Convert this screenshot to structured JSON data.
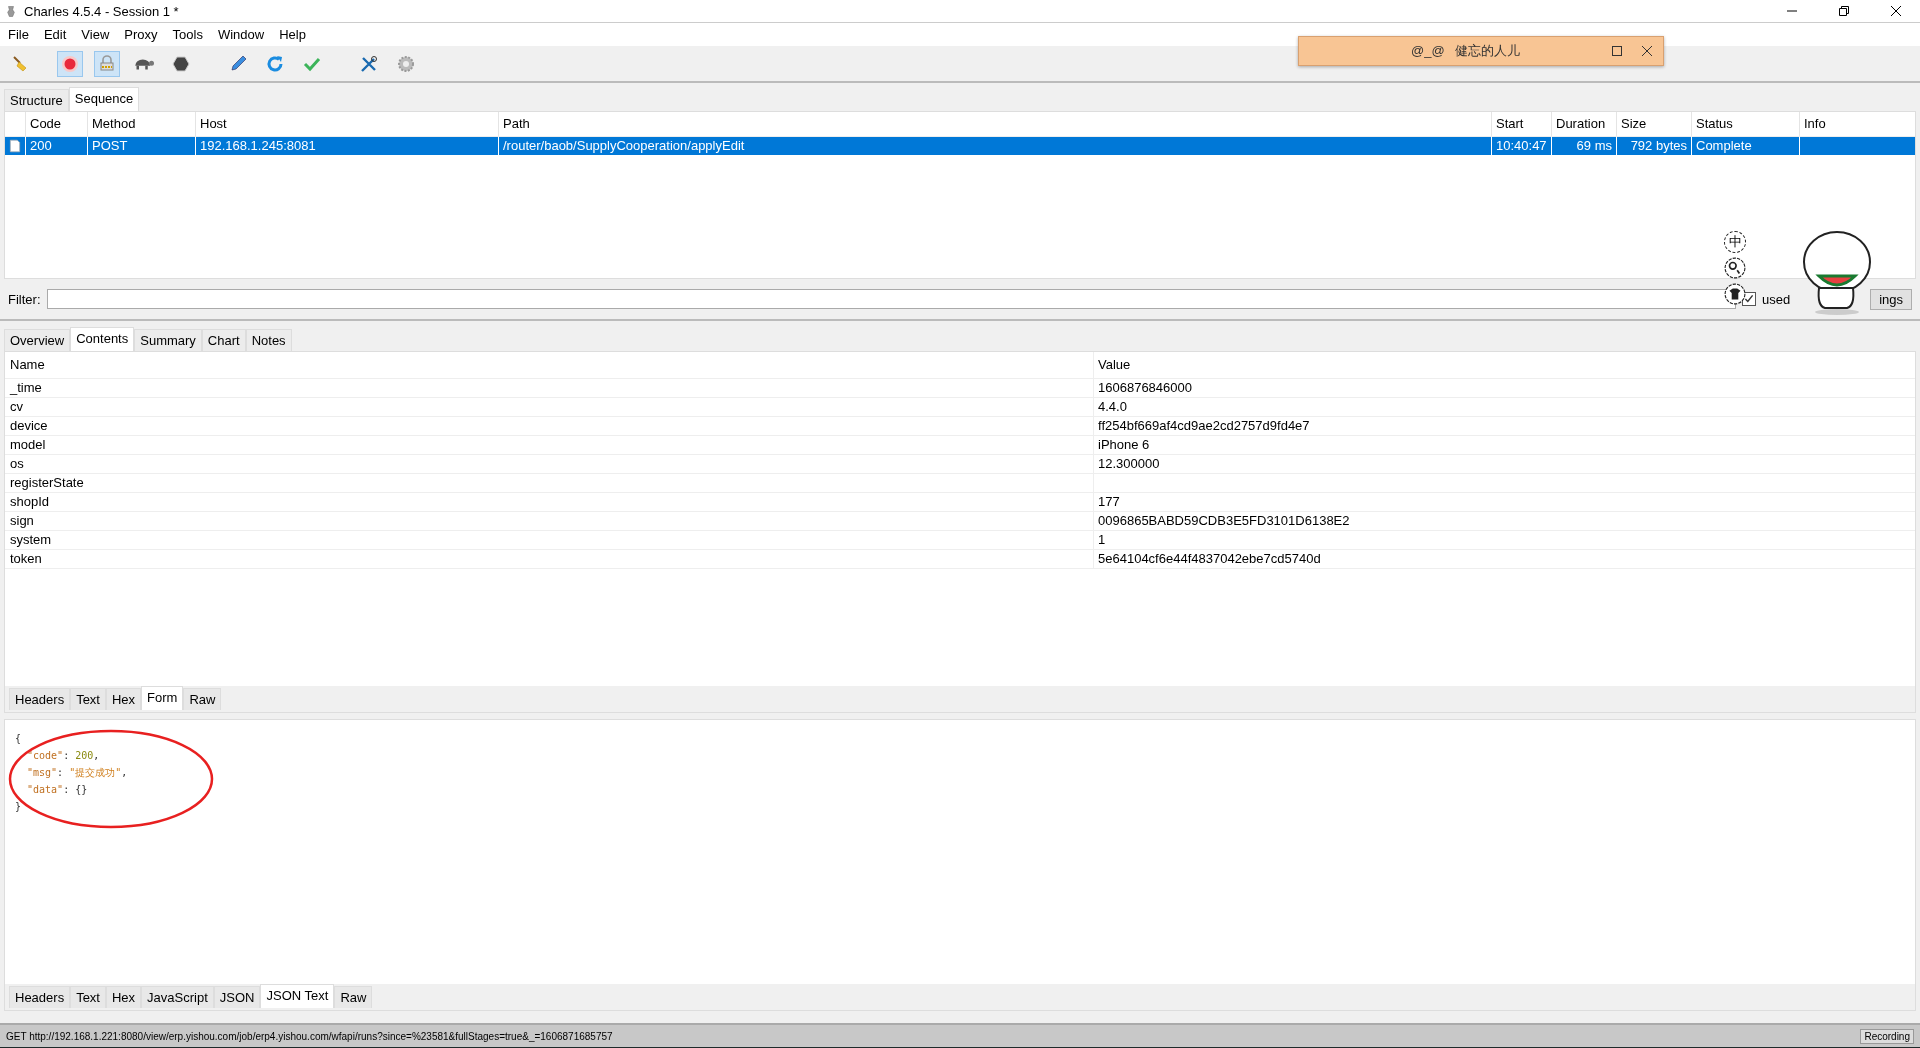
{
  "window": {
    "title": "Charles 4.5.4 - Session 1 *"
  },
  "menu": [
    "File",
    "Edit",
    "View",
    "Proxy",
    "Tools",
    "Window",
    "Help"
  ],
  "toolbar": [
    {
      "kind": "broom",
      "on": false
    },
    {
      "kind": "record",
      "on": true
    },
    {
      "kind": "throttle",
      "on": true
    },
    {
      "kind": "turtle",
      "on": false
    },
    {
      "kind": "stop",
      "on": false
    },
    {
      "kind": "pen",
      "on": false
    },
    {
      "kind": "refresh",
      "on": false
    },
    {
      "kind": "check",
      "on": false
    },
    {
      "kind": "tools",
      "on": false
    },
    {
      "kind": "gear",
      "on": false
    }
  ],
  "notification": {
    "text": "@_@   健忘的人儿"
  },
  "view_tabs": [
    {
      "label": "Structure",
      "selected": false
    },
    {
      "label": "Sequence",
      "selected": true
    }
  ],
  "table": {
    "columns": [
      "Code",
      "Method",
      "Host",
      "Path",
      "Start",
      "Duration",
      "Size",
      "Status",
      "Info"
    ],
    "rows": [
      {
        "selected": true,
        "cells": [
          "200",
          "POST",
          "192.168.1.245:8081",
          "/router/baob/SupplyCooperation/applyEdit",
          "10:40:47",
          "69 ms",
          "792 bytes",
          "Complete",
          ""
        ]
      }
    ]
  },
  "filter": {
    "label": "Filter:",
    "focused_checked": true,
    "checkbox_label": "used",
    "settings_button": "ings"
  },
  "overlay_badge": "中",
  "detail_tabs": [
    {
      "label": "Overview",
      "selected": false
    },
    {
      "label": "Contents",
      "selected": true
    },
    {
      "label": "Summary",
      "selected": false
    },
    {
      "label": "Chart",
      "selected": false
    },
    {
      "label": "Notes",
      "selected": false
    }
  ],
  "form": {
    "columns": [
      "Name",
      "Value"
    ],
    "rows": [
      {
        "name": "_time",
        "value": "1606876846000"
      },
      {
        "name": "cv",
        "value": "4.4.0"
      },
      {
        "name": "device",
        "value": "ff254bf669af4cd9ae2cd2757d9fd4e7"
      },
      {
        "name": "model",
        "value": "iPhone 6"
      },
      {
        "name": "os",
        "value": "12.300000"
      },
      {
        "name": "registerState",
        "value": ""
      },
      {
        "name": "shopId",
        "value": "177"
      },
      {
        "name": "sign",
        "value": "0096865BABD59CDB3E5FD3101D6138E2"
      },
      {
        "name": "system",
        "value": "1"
      },
      {
        "name": "token",
        "value": "5e64104cf6e44f4837042ebe7cd5740d"
      }
    ]
  },
  "request_tabs": [
    {
      "label": "Headers",
      "selected": false
    },
    {
      "label": "Text",
      "selected": false
    },
    {
      "label": "Hex",
      "selected": false
    },
    {
      "label": "Form",
      "selected": true
    },
    {
      "label": "Raw",
      "selected": false
    }
  ],
  "json_text": [
    {
      "tokens": [
        {
          "kind": "punct",
          "text": "{"
        }
      ]
    },
    {
      "tokens": [
        {
          "kind": "key",
          "text": "\"code\""
        },
        {
          "kind": "punct",
          "text": ": "
        },
        {
          "kind": "number",
          "text": "200"
        },
        {
          "kind": "punct",
          "text": ","
        }
      ]
    },
    {
      "tokens": [
        {
          "kind": "key",
          "text": "\"msg\""
        },
        {
          "kind": "punct",
          "text": ": "
        },
        {
          "kind": "string",
          "text": "\"提交成功\""
        },
        {
          "kind": "punct",
          "text": ","
        }
      ]
    },
    {
      "tokens": [
        {
          "kind": "key",
          "text": "\"data\""
        },
        {
          "kind": "punct",
          "text": ": "
        },
        {
          "kind": "punct",
          "text": "{}"
        }
      ]
    },
    {
      "tokens": [
        {
          "kind": "punct",
          "text": "}"
        }
      ]
    }
  ],
  "response_tabs": [
    {
      "label": "Headers",
      "selected": false
    },
    {
      "label": "Text",
      "selected": false
    },
    {
      "label": "Hex",
      "selected": false
    },
    {
      "label": "JavaScript",
      "selected": false
    },
    {
      "label": "JSON",
      "selected": false
    },
    {
      "label": "JSON Text",
      "selected": true
    },
    {
      "label": "Raw",
      "selected": false
    }
  ],
  "status_bar": {
    "text": "GET http://192.168.1.221:8080/view/erp.yishou.com/job/erp4.yishou.com/wfapi/runs?since=%23581&fullStages=true&_=1606871685757",
    "recording": "Recording"
  }
}
